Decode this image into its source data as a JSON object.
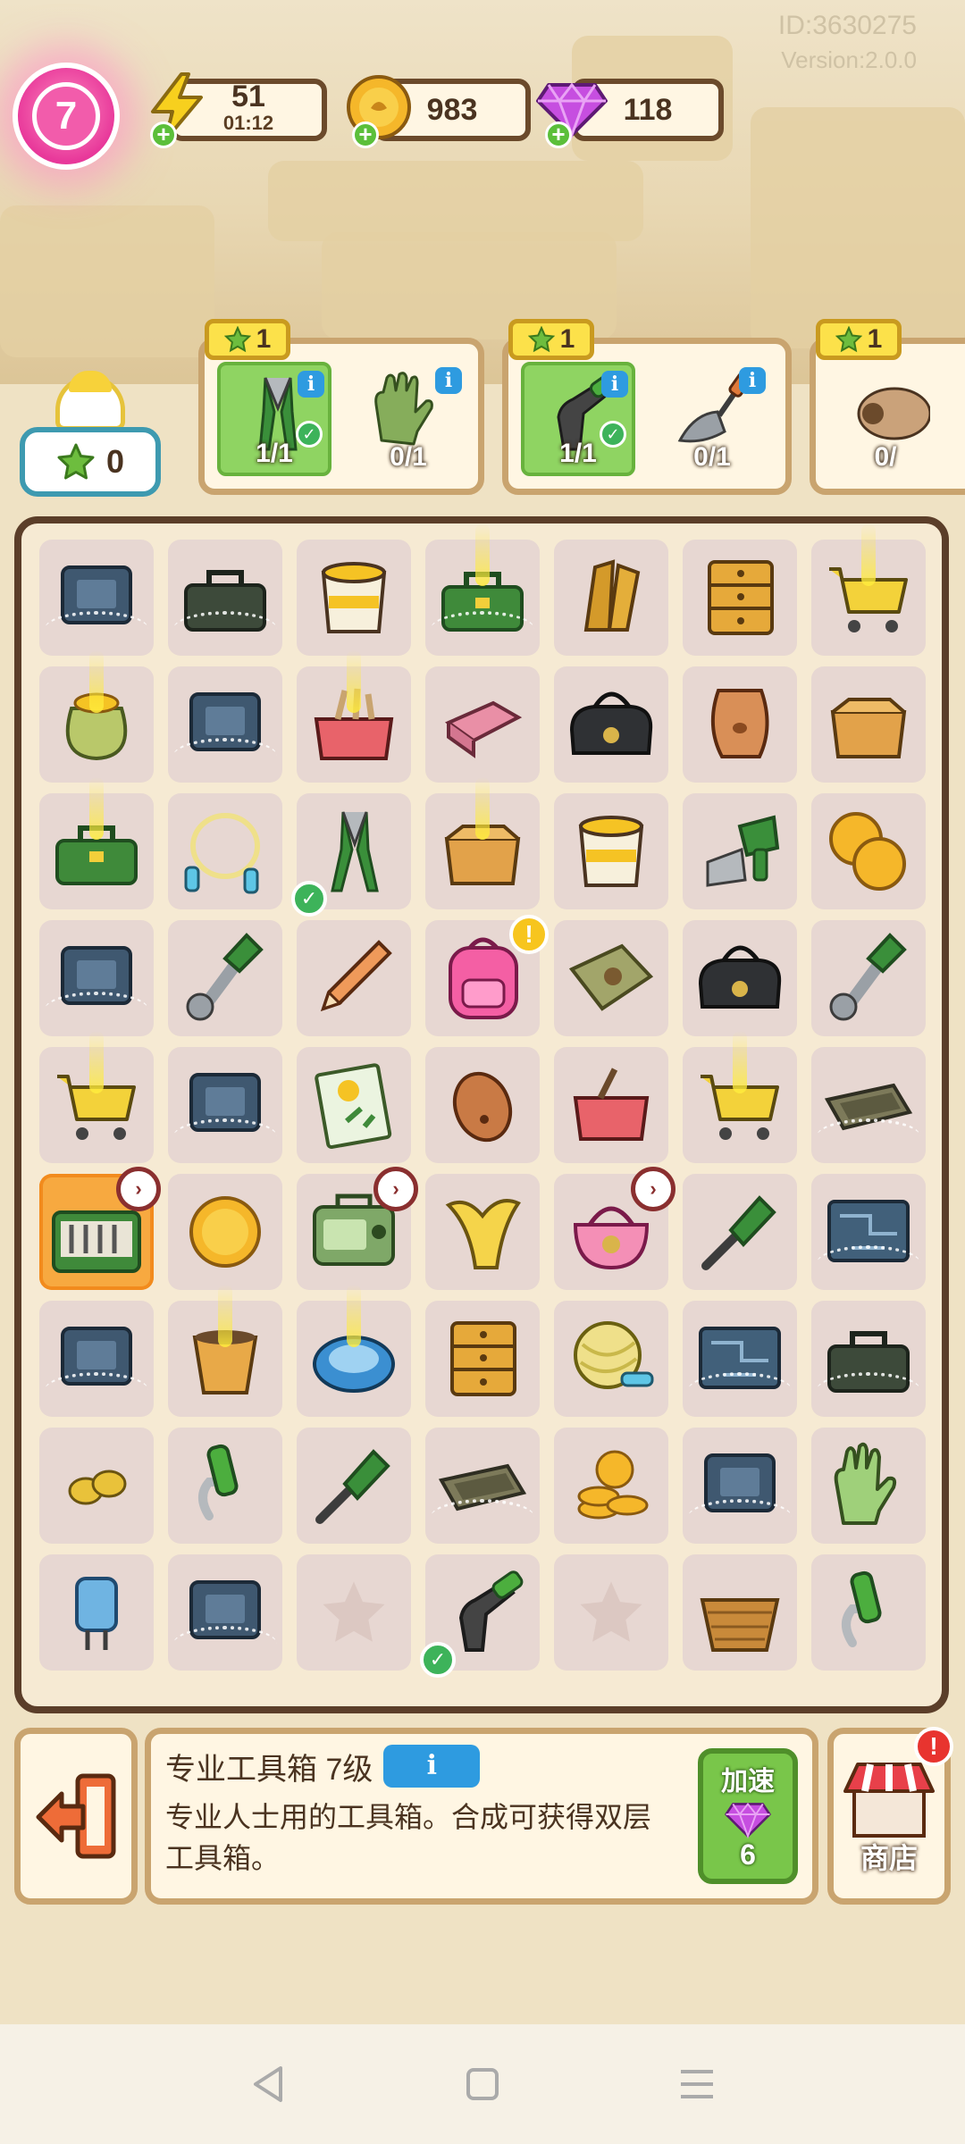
{
  "header": {
    "player_id": "ID:3630275",
    "version": "Version:2.0.0",
    "level": "7",
    "energy": {
      "value": "51",
      "timer": "01:12",
      "icon": "lightning-icon"
    },
    "coins": {
      "value": "983",
      "icon": "coin-icon"
    },
    "gems": {
      "value": "118",
      "icon": "gem-icon"
    }
  },
  "star_counter": {
    "value": "0"
  },
  "orders": [
    {
      "reward": "1",
      "items": [
        {
          "name": "pliers",
          "count": "1/1",
          "done": true
        },
        {
          "name": "gloves",
          "count": "0/1",
          "done": false
        }
      ]
    },
    {
      "reward": "1",
      "items": [
        {
          "name": "spray-nozzle",
          "count": "1/1",
          "done": true
        },
        {
          "name": "trowel",
          "count": "0/1",
          "done": false
        }
      ]
    },
    {
      "reward": "1",
      "items": [
        {
          "name": "hair-dryer",
          "count": "0/",
          "done": false
        }
      ]
    }
  ],
  "board": {
    "rows": [
      [
        "cpu-chip",
        "toolbox-dark",
        "paint-bucket",
        "toolbox-green",
        "cardboard-pieces",
        "drawer-cabinet",
        "shopping-cart"
      ],
      [
        "coin-sack",
        "cpu-chip",
        "tool-crate",
        "brick",
        "duffel-bag",
        "clay-pot",
        "cardboard-box"
      ],
      [
        "toolbox-green",
        "jump-rope",
        "pliers",
        "cardboard-box",
        "paint-bucket",
        "saw-drill",
        "coin-pile"
      ],
      [
        "cpu-chip",
        "wrench",
        "pencil",
        "pink-backpack",
        "seed-bag",
        "duffel-bag",
        "wrench"
      ],
      [
        "shopping-cart",
        "cpu-chip",
        "seed-packet",
        "potato",
        "planter-box",
        "shopping-cart",
        "tray"
      ],
      [
        "pro-toolbox",
        "coin",
        "radio",
        "banana-peel",
        "pink-handbag",
        "screwdriver",
        "circuit-board"
      ],
      [
        "cpu-chip",
        "flower-pot",
        "robot-vacuum",
        "drawer-cabinet",
        "yarn-ball",
        "circuit-board",
        "toolbox-dark"
      ],
      [
        "peanut",
        "spray-hose",
        "screwdriver",
        "tray",
        "coin-stack",
        "cpu-chip",
        "gloves"
      ],
      [
        "capacitor",
        "cpu-chip",
        "empty",
        "spray-nozzle",
        "empty",
        "wicker-basket",
        "spray-hose"
      ]
    ]
  },
  "selected_item": {
    "title": "专业工具箱 7级",
    "info_label": "i",
    "description": "专业人士用的工具箱。合成可获得双层工具箱。",
    "speed_label": "加速",
    "speed_cost": "6"
  },
  "shop": {
    "label": "商店",
    "alert": "!"
  },
  "colors": {
    "accent": "#c9a46f",
    "border": "#5b3e29",
    "green": "#79c64a",
    "blue": "#2e9be0",
    "pink": "#e8389a"
  }
}
